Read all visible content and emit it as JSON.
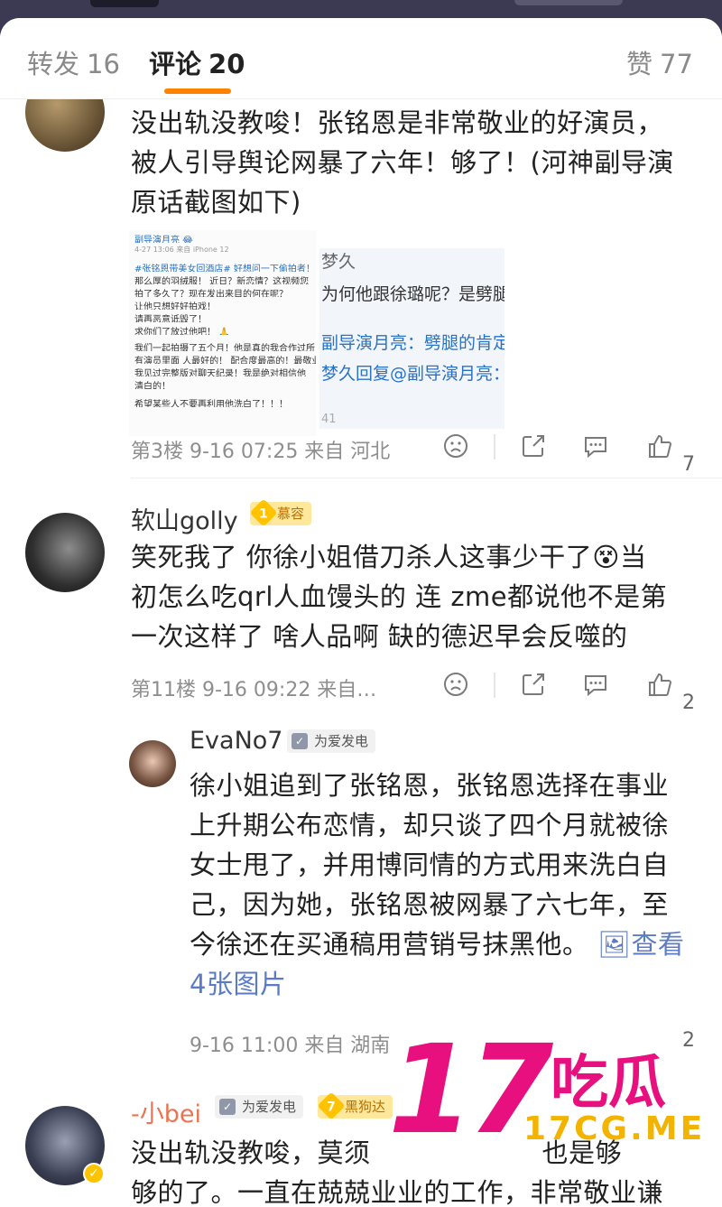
{
  "tabs": {
    "repost_label": "转发",
    "repost_count": "16",
    "comment_label": "评论",
    "comment_count": "20",
    "like_label": "赞",
    "like_count": "77"
  },
  "comments": [
    {
      "text_lines": [
        "没出轨没教唆！张铭恩是非常敬业的好演员，",
        "被人引导舆论网暴了六年！够了！(河神副导演",
        "原话截图如下)"
      ],
      "image1": {
        "lines": [
          "副导演月亮 😂",
          "4-27 13:06 来自 iPhone 12",
          "#张铭恩带美女回酒店# 好想问一下偷拍者！！",
          "那么厚的羽绒服！ 近日？新恋情？这视频您",
          "拍了多久了？现在发出来目的何在呢？",
          "让他只想好好拍戏！",
          "请再恶意诋毁了！",
          "求你们了放过他吧！ 🙏",
          "我们一起拍摄了五个月！他是真的我合作过所",
          "有演员里面 人最好的！ 配合度最高的！最敬业",
          "我见过完整版对聊天纪录！我是绝对相信他",
          "清白的！",
          "希望某些人不要再利用他洗白了！！！"
        ]
      },
      "image2": {
        "lines": [
          "梦久",
          "为何他跟徐璐呢？是劈腿了",
          "副导演月亮：劈腿的肯定不是他",
          "梦久回复@副导演月亮：",
          "41"
        ]
      },
      "meta": "第3楼 9-16 07:25 来自 河北",
      "like_count": "7"
    },
    {
      "username": "软山golly",
      "badge": "慕容",
      "badge_level": "1",
      "text_lines": [
        "笑死我了 你徐小姐借刀杀人这事少干了😵当",
        "初怎么吃qrl人血馒头的 连 zme都说他不是第",
        "一次这样了 啥人品啊 缺的德迟早会反噬的"
      ],
      "meta": "第11楼 9-16 09:22 来自…",
      "like_count": "2"
    },
    {
      "username": "EvaNo7",
      "badge": "为爱发电",
      "text_lines": [
        "徐小姐追到了张铭恩，张铭恩选择在事业",
        "上升期公布恋情，却只谈了四个月就被徐",
        "女士甩了，并用博同情的方式用来洗白自",
        "己，因为她，张铭恩被网暴了六七年，至",
        "今徐还在买通稿用营销号抹黑他。"
      ],
      "link1": "🖼查看",
      "link2": "4张图片",
      "meta": "9-16 11:00 来自 湖南",
      "like_count": "2"
    },
    {
      "username": "-小bei",
      "badge": "为爱发电",
      "badge2": "黑狗达",
      "badge2_level": "7",
      "text_lines": [
        "没出轨没教唆，莫须",
        "够的了。一直在兢兢业业的工作，非常敬业谦"
      ],
      "text_tail": "也是够"
    }
  ],
  "watermark": {
    "big": "17",
    "text": "吃瓜",
    "url": "17CG.ME"
  },
  "colors": {
    "accent": "#ff8200",
    "link": "#5b7cc4",
    "watermark": "#e8107f",
    "watermark_url": "#f2b400"
  },
  "icons": [
    "sad-face-icon",
    "share-icon",
    "comment-icon",
    "thumbs-up-icon",
    "image-icon",
    "verified-icon"
  ]
}
